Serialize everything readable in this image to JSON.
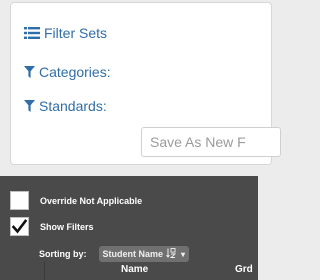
{
  "filter_panel": {
    "filter_sets_label": "Filter Sets",
    "categories_label": "Categories:",
    "standards_label": "Standards:",
    "save_button_label": "Save As New F"
  },
  "options_panel": {
    "override_label": "Override Not Applicable",
    "override_checked": false,
    "show_filters_label": "Show Filters",
    "show_filters_checked": true,
    "sorting_label": "Sorting by:",
    "sort_value": "Student Name",
    "sort_icon": "sort-alpha-icon"
  },
  "table_header": {
    "columns": [
      "Name",
      "Grd"
    ]
  },
  "colors": {
    "link_blue": "#2f6ea8",
    "dark_panel": "#4a4a4a",
    "select_bg": "#707070"
  }
}
